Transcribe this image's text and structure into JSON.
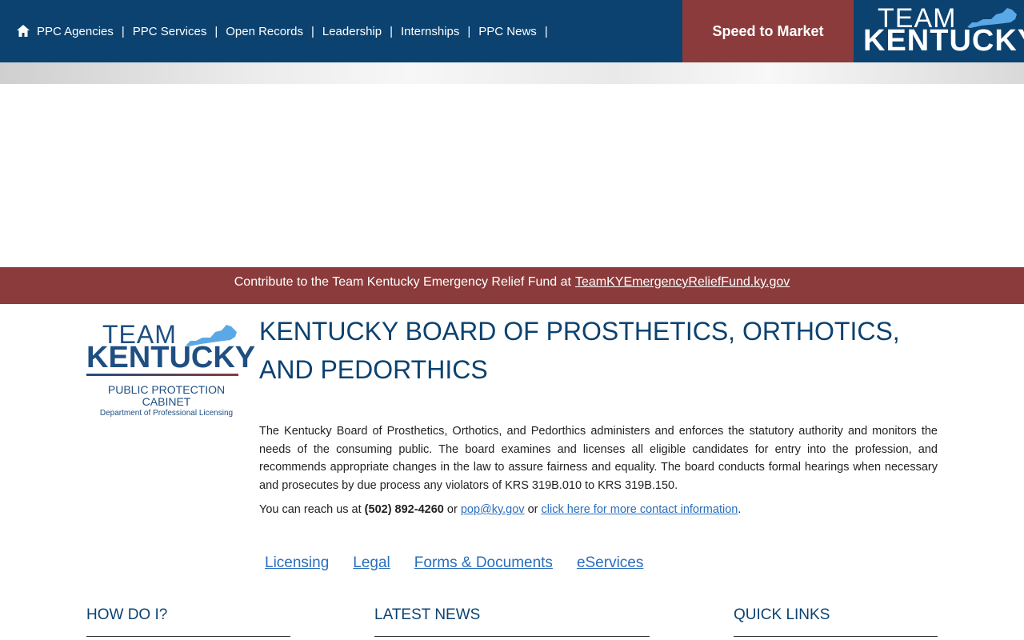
{
  "nav": {
    "items": [
      {
        "label": "PPC Agencies"
      },
      {
        "label": "PPC Services"
      },
      {
        "label": "Open Records"
      },
      {
        "label": "Leadership"
      },
      {
        "label": "Internships"
      },
      {
        "label": "PPC News"
      }
    ],
    "separator": "|",
    "speed_button": "Speed to Market",
    "logo_line1": "TEAM",
    "logo_line2": "KENTUCKY"
  },
  "relief": {
    "text": "Contribute to the Team Kentucky Emergency Relief Fund at",
    "link": "TeamKYEmergencyReliefFund.ky.gov"
  },
  "cabinet_logo": {
    "line1": "TEAM",
    "line2": "KENTUCKY",
    "line3": "PUBLIC PROTECTION",
    "line4": "CABINET",
    "line5": "Department of Professional Licensing"
  },
  "main": {
    "title": "KENTUCKY BOARD OF PROSTHETICS, ORTHOTICS, AND PEDORTHICS",
    "description": "The Kentucky Board of Prosthetics, Orthotics, and Pedorthics administers and enforces the statutory authority and monitors the needs of the consuming public. The board examines and licenses all eligible candidates for entry into the profession, and recommends appropriate changes in the law to assure fairness and equality. The board conducts formal hearings when necessary and prosecutes by due process any violators of KRS 319B.010 to KRS 319B.150.",
    "contact": {
      "prefix": "You can reach us at",
      "phone": "(502) 892-4260",
      "or1": "or",
      "email": "pop@ky.gov",
      "or2": "or",
      "more_link": "click here for more contact information",
      "suffix": "."
    },
    "tabs": [
      {
        "label": "Licensing"
      },
      {
        "label": "Legal"
      },
      {
        "label": "Forms & Documents"
      },
      {
        "label": "eServices"
      }
    ]
  },
  "sections": {
    "how_do_i": "HOW DO I?",
    "latest_news": "LATEST NEWS",
    "quick_links": "QUICK LINKS"
  },
  "colors": {
    "navy": "#0b4270",
    "maroon": "#8b3b3b",
    "link": "#2a6ebd"
  }
}
